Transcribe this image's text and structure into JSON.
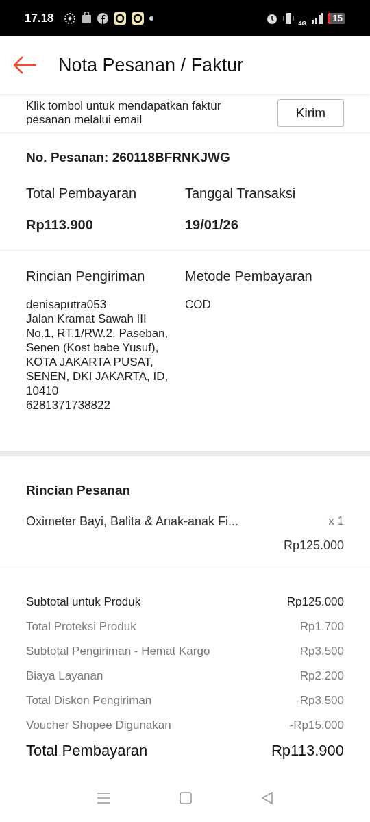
{
  "status_bar": {
    "time": "17.18",
    "network": "4G",
    "battery": "15"
  },
  "header": {
    "title": "Nota Pesanan / Faktur"
  },
  "email_invoice": {
    "text": "Klik tombol untuk mendapatkan faktur pesanan melalui email",
    "button": "Kirim"
  },
  "order": {
    "number": "No. Pesanan: 260118BFRNKJWG",
    "total_label": "Total Pembayaran",
    "total_value": "Rp113.900",
    "date_label": "Tanggal Transaksi",
    "date_value": "19/01/26"
  },
  "shipping": {
    "label": "Rincian Pengiriman",
    "lines": [
      "denisaputra053",
      "Jalan Kramat Sawah III No.1, RT.1/RW.2, Paseban, Senen (Kost babe Yusuf), KOTA JAKARTA PUSAT, SENEN, DKI JAKARTA, ID, 10410",
      "6281371738822"
    ]
  },
  "payment": {
    "label": "Metode Pembayaran",
    "value": "COD"
  },
  "order_details": {
    "title": "Rincian Pesanan",
    "items": [
      {
        "name": "Oximeter Bayi, Balita & Anak-anak Fi...",
        "quantity": "x 1",
        "price": "Rp125.000"
      }
    ]
  },
  "summary": [
    {
      "kind": "main",
      "label": "Subtotal untuk Produk",
      "value": "Rp125.000"
    },
    {
      "kind": "detail",
      "label": "Total Proteksi Produk",
      "value": "Rp1.700"
    },
    {
      "kind": "detail",
      "label": "Subtotal Pengiriman - Hemat Kargo",
      "value": "Rp3.500"
    },
    {
      "kind": "detail",
      "label": "Biaya Layanan",
      "value": "Rp2.200"
    },
    {
      "kind": "detail",
      "label": "Total Diskon Pengiriman",
      "value": "-Rp3.500"
    },
    {
      "kind": "detail",
      "label": "Voucher Shopee Digunakan",
      "value": "-Rp15.000"
    },
    {
      "kind": "total",
      "label": "Total Pembayaran",
      "value": "Rp113.900"
    }
  ]
}
